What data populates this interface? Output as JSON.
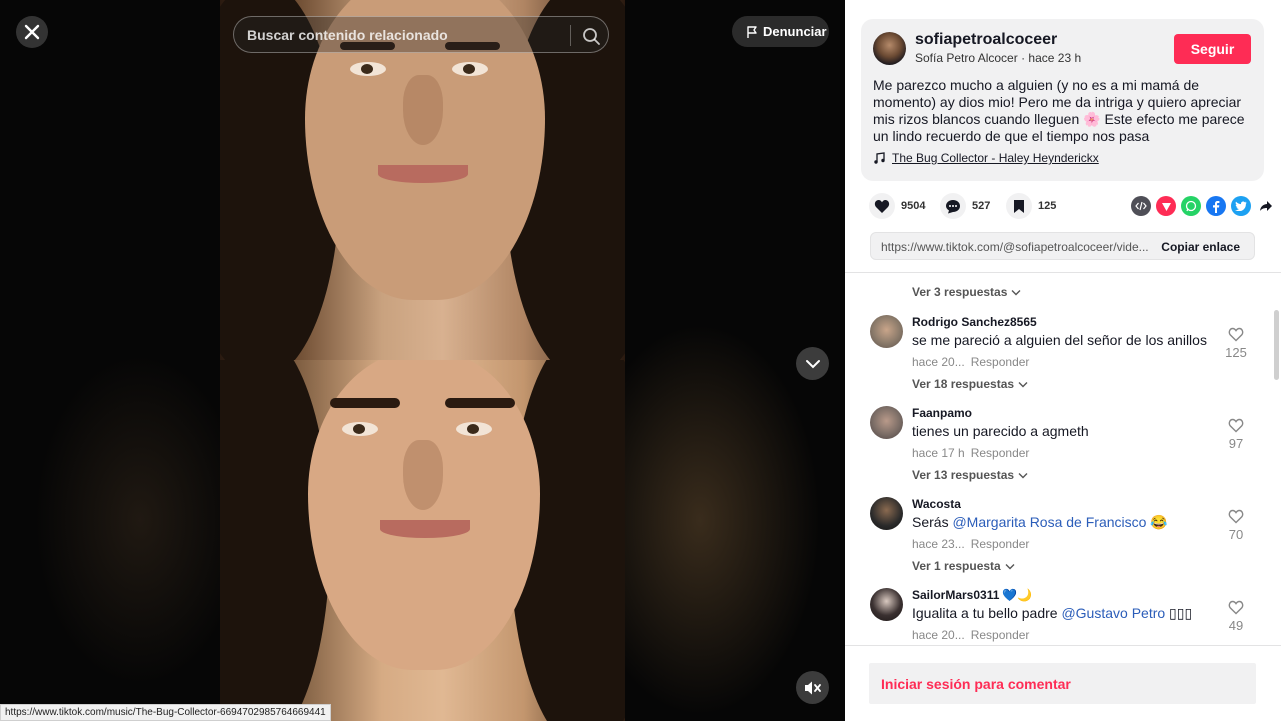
{
  "video": {
    "search_placeholder": "Buscar contenido relacionado",
    "report_label": "Denunciar",
    "status_url": "https://www.tiktok.com/music/The-Bug-Collector-6694702985764669441"
  },
  "post": {
    "username": "sofiapetroalcoceer",
    "display_name": "Sofía Petro Alcocer",
    "time": "hace 23 h",
    "follow_label": "Seguir",
    "description": "Me parezco mucho a alguien (y no es a mi mamá de momento) ay dios mio! Pero me da intriga y quiero apreciar mis rizos blancos cuando lleguen 🌸 Este efecto me parece un lindo recuerdo de que el tiempo nos pasa",
    "music": "The Bug Collector - Haley Heynderickx",
    "likes": "9504",
    "comments_count": "527",
    "saves": "125",
    "link": "https://www.tiktok.com/@sofiapetroalcoceer/vide...",
    "copy_link_label": "Copiar enlace"
  },
  "comments": {
    "top_view_replies": "Ver 3 respuestas",
    "items": [
      {
        "user": "Rodrigo Sanchez8565",
        "text": "se me pareció a alguien del señor de los anillos",
        "mention": "",
        "suffix": "",
        "time": "hace 20...",
        "reply": "Responder",
        "likes": "125",
        "view_replies": "Ver 18 respuestas",
        "avatar_color": "#8a7a6a"
      },
      {
        "user": "Faanpamo",
        "text": "tienes un parecido a agmeth",
        "mention": "",
        "suffix": "",
        "time": "hace 17 h",
        "reply": "Responder",
        "likes": "97",
        "view_replies": "Ver 13 respuestas",
        "avatar_color": "#7b6d66"
      },
      {
        "user": "Wacosta",
        "text": "Serás ",
        "mention": "@Margarita Rosa de Francisco",
        "suffix": " 😂",
        "time": "hace 23...",
        "reply": "Responder",
        "likes": "70",
        "view_replies": "Ver 1 respuesta",
        "avatar_color": "#2a2a2a"
      },
      {
        "user": "SailorMars0311",
        "user_suffix": "💙🌙",
        "text": "Igualita a tu bello padre ",
        "mention": "@Gustavo Petro",
        "suffix": " ▯▯▯",
        "time": "hace 20...",
        "reply": "Responder",
        "likes": "49",
        "view_replies": "",
        "avatar_color": "#3a3030"
      }
    ]
  },
  "login_prompt": "Iniciar sesión para comentar",
  "colors": {
    "accent": "#fe2c55",
    "mention": "#2b5db9"
  }
}
